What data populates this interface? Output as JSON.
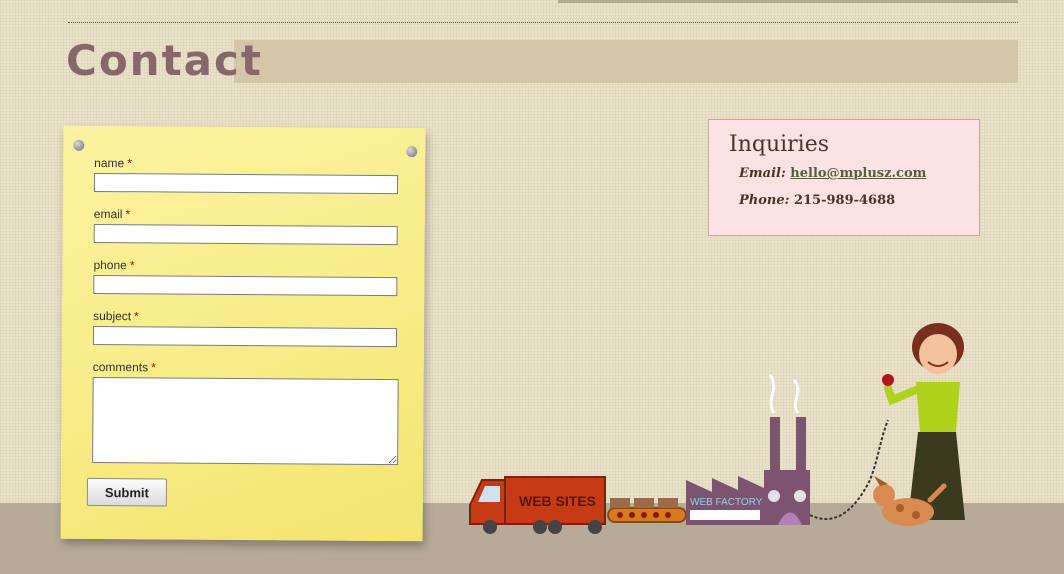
{
  "page": {
    "title": "Contact"
  },
  "form": {
    "required_marker": "*",
    "fields": [
      {
        "label": "name",
        "value": ""
      },
      {
        "label": "email",
        "value": ""
      },
      {
        "label": "phone",
        "value": ""
      },
      {
        "label": "subject",
        "value": ""
      },
      {
        "label": "comments",
        "value": ""
      }
    ],
    "submit_label": "Submit"
  },
  "inquiries": {
    "title": "Inquiries",
    "email_label": "Email:",
    "email": "hello@mplusz.com",
    "phone_label": "Phone:",
    "phone": "215-989-4688"
  },
  "illustration": {
    "truck_text": "WEB SITES",
    "factory_text": "WEB FACTORY"
  }
}
